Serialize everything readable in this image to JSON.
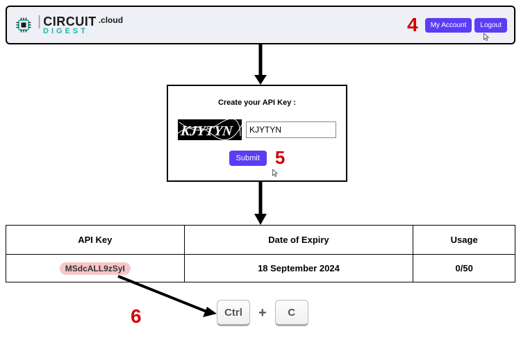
{
  "logo": {
    "circuit": "CIRCUIT",
    "digest": "DIGEST",
    "cloud": ".cloud"
  },
  "header": {
    "my_account_label": "My Account",
    "logout_label": "Logout"
  },
  "annotations": {
    "n4": "4",
    "n5": "5",
    "n6": "6"
  },
  "captcha": {
    "title": "Create your API Key :",
    "image_text": "KJYTYN",
    "input_value": "KJYTYN",
    "submit_label": "Submit"
  },
  "table": {
    "headers": [
      "API Key",
      "Date of Expiry",
      "Usage"
    ],
    "row": {
      "api_key": "MSdcALL9zSyI",
      "expiry": "18 September 2024",
      "usage": "0/50"
    }
  },
  "keys": {
    "ctrl": "Ctrl",
    "plus": "+",
    "c": "C"
  }
}
